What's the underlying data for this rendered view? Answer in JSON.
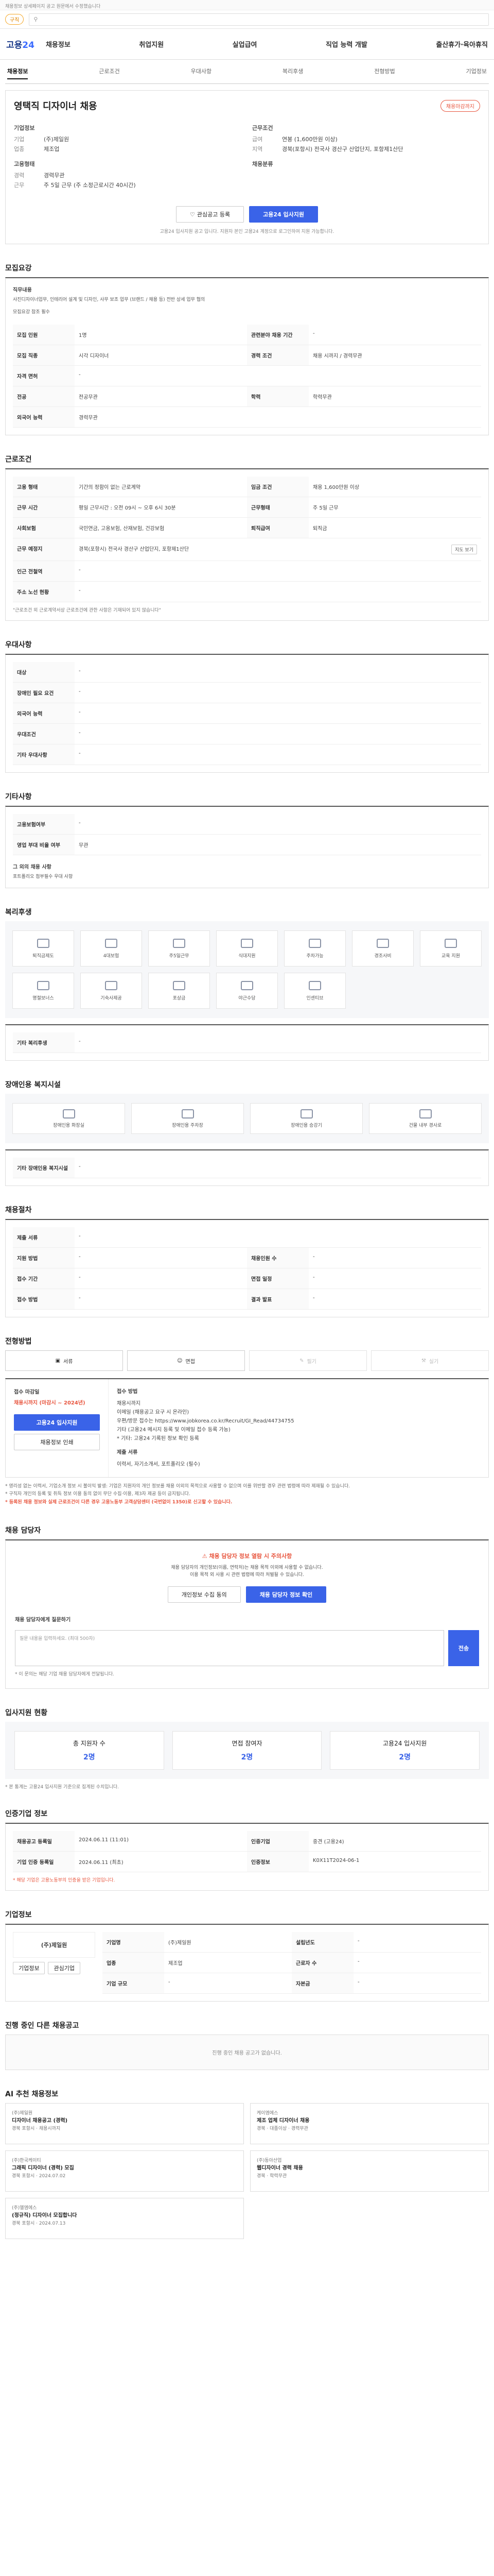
{
  "top_notice": "채용정보 상세페이지 공고 원문에서 수정했습니다",
  "topbar": {
    "chip": "구직",
    "search_placeholder": ""
  },
  "gnb": {
    "logo_a": "고용",
    "logo_b": "24",
    "menu": [
      "채용정보",
      "취업지원",
      "실업급여",
      "직업 능력 개발",
      "출산휴가·육아휴직"
    ]
  },
  "tabs": [
    "채용정보",
    "근로조건",
    "우대사항",
    "복리후생",
    "전형방법",
    "기업정보"
  ],
  "header": {
    "title": "영택직 디자이너 채용",
    "badge": "채용마감까지",
    "company_lbl": "기업정보",
    "company": [
      {
        "k": "기업",
        "v": "(주)제일원"
      },
      {
        "k": "업종",
        "v": "제조업"
      }
    ],
    "cond_lbl": "근무조건",
    "cond": [
      {
        "k": "급여",
        "v": "연봉 (1,600만원 이상)"
      },
      {
        "k": "지역",
        "v": "경북(포항시) 전국사 경산구 산업단지, 포항제1산단"
      }
    ],
    "req_lbl": "고용형태",
    "req": [
      {
        "k": "경력",
        "v": "경력무관"
      },
      {
        "k": "근무",
        "v": "주 5일 근무 (주 소정근로시간 40시간)"
      }
    ],
    "emp_lbl": "채용분류",
    "scrap": "관심공고 등록",
    "apply": "고용24 입사지원",
    "notice": "고용24 입사지원 공고 입니다. 지원자 본인 고용24 계정으로 로그인하여 지원 가능합니다."
  },
  "job": {
    "title": "모집요강",
    "duty_lbl": "직무내용",
    "duty": "사진디자이너업무, 인테리어 설계 및 디자인, 사무 보조 업무 (브랜드 / 채용 등) 전반 상세 업무 협의",
    "etc": "모집요강 참조 필수",
    "rows": [
      [
        "모집 인원",
        "1명",
        "관련분야 채용 기간",
        "-"
      ],
      [
        "모집 직종",
        "시각 디자이너",
        "경력 조건",
        "채용 시까지 / 경력무관"
      ],
      [
        "자격 면허",
        "-",
        "",
        ""
      ],
      [
        "전공",
        "전공무관",
        "학력",
        "학력무관"
      ],
      [
        "외국어 능력",
        "경력무관",
        "",
        ""
      ]
    ]
  },
  "work": {
    "title": "근로조건",
    "rows": [
      [
        "고용 형태",
        "기간의 정함이 없는 근로계약",
        "임금 조건",
        "채용 1,600만원 이상"
      ],
      [
        "근무 시간",
        "평일 근무시간 : 오전 09시 ~ 오후 6시 30분",
        "",
        ""
      ],
      [
        "사회보험",
        "국민연금, 고용보험, 산재보험, 건강보험",
        "퇴직급여",
        "퇴직금"
      ],
      [
        "근무 예정지",
        "경북(포항시) 전국사 경산구 산업단지, 포항제1산단",
        "",
        "지도 보기"
      ],
      [
        "인근 전철역",
        "-",
        "",
        ""
      ],
      [
        "주소 노선 현황",
        "-",
        "",
        ""
      ]
    ],
    "weekly": "주 5일 근무",
    "note": "\"근로조건 외 근로계약서상 근로조건에 관한 사항은 기재되어 있지 않습니다\""
  },
  "pref": {
    "title": "우대사항",
    "rows": [
      [
        "대상",
        "-"
      ],
      [
        "장애인 필요 요건",
        "-"
      ],
      [
        "외국어 능력",
        "-"
      ],
      [
        "우대조건",
        "-"
      ],
      [
        "기타 우대사항",
        "-"
      ]
    ]
  },
  "etc": {
    "title": "기타사항",
    "rows": [
      [
        "고용보험여부",
        "-"
      ],
      [
        "영업 부대 비율 여부",
        "무관"
      ]
    ],
    "cert_lbl": "그 외의 채용 사항",
    "cert": "포트폴리오 첨부필수 우대 사항"
  },
  "welfare": {
    "title": "복리후생",
    "items": [
      "퇴직금제도",
      "4대보험",
      "주5일근무",
      "식대지원",
      "주차가능",
      "경조사비",
      "교육 지원",
      "명절보너스",
      "기숙사제공",
      "포상금",
      "야근수당",
      "인센티브"
    ],
    "etc_lbl": "기타 복리후생",
    "etc": "-"
  },
  "disab": {
    "title": "장애인용 복지시설",
    "items": [
      "장애인용 화장실",
      "장애인용 주차장",
      "장애인용 승강기",
      "건물 내부 경사로"
    ],
    "etc_lbl": "기타 장애인용 복지시설",
    "etc": "-"
  },
  "hire": {
    "title": "채용절차",
    "rows": [
      [
        "제출 서류",
        "-",
        "",
        ""
      ],
      [
        "지원 방법",
        "-",
        "채용인원 수",
        "-"
      ],
      [
        "접수 기간",
        "-",
        "면접 일정",
        "-"
      ],
      [
        "접수 방법",
        "-",
        "결과 발표",
        "-"
      ]
    ]
  },
  "method": {
    "title": "전형방법",
    "items": [
      "서류",
      "면접",
      "필기",
      "실기"
    ]
  },
  "applyx": {
    "title_l": "접수 마감일",
    "deadline": "채용시까지 (마감시 ~ 2024년)",
    "apply": "고용24 입사지원",
    "print": "채용정보 인쇄",
    "title_r": "접수 방법",
    "lines": [
      "채용시까지",
      "이메일 (채용공고 요구 시 온라인)",
      "우편/방문 접수는 https://www.jobkorea.co.kr/Recruit/GI_Read/44734755",
      "기타 (고용24 메시지 등록 및 이메일 접수 등록 가능)",
      "* 기타: 고용24 기록된 정보 확인 등록"
    ],
    "sub_lbl": "제출 서류",
    "subs": "이력서, 자기소개서, 포트폴리오 (필수)"
  },
  "caution": [
    "* 영리성 없는 이력서, 기업소개 정보 시 불이익 발생: 기업은 지원자의 개인 정보를 채용 이외의 목적으로 사용할 수 없으며 이를 위반할 경우 관련 법령에 따라 제재될 수 있습니다.",
    "* 구직자 개인의 등록 및 취득 정보 이용 동의 없이 무단 수집·이용, 제3자 제공 등이 금지됩니다.",
    "* 등록된 채용 정보와 실제 근로조건이 다른 경우 고용노동부 고객상담센터 (국번없이 1350)로 신고할 수 있습니다."
  ],
  "inquiry": {
    "title": "채용 담당자",
    "warn": "채용 담당자 정보 열람 시 주의사항",
    "t1": "채용 담당자의 개인정보(이름, 연락처)는 채용 목적 이외에 사용할 수 없습니다.",
    "t2": "이용 목적 외 사용 시 관련 법령에 따라 처벌될 수 있습니다.",
    "b1": "개인정보 수집 동의",
    "b2": "채용 담당자 정보 확인",
    "q_lbl": "채용 담당자에게 질문하기",
    "q_ph": "질문 내용을 입력하세요. (최대 500자)",
    "send": "전송",
    "q_note": "* 이 문의는 해당 기업 채용 담당자에게 전달됩니다."
  },
  "stats": {
    "title": "입사지원 현황",
    "items": [
      {
        "k": "총 지원자 수",
        "v": "2명"
      },
      {
        "k": "면접 참여자",
        "v": "2명"
      },
      {
        "k": "고용24 입사지원",
        "v": "2명"
      }
    ],
    "note": "* 본 통계는 고용24 입사지원 기준으로 집계된 수치입니다."
  },
  "corp": {
    "title": "인증기업 정보",
    "rows": [
      [
        "채용공고 등록일",
        "2024.06.11 (11:01)",
        "인증기업",
        "중견 (고용24)"
      ],
      [
        "기업 인증 등록일",
        "2024.06.11 (최초)",
        "인증정보",
        "K0X11T2024-06-1"
      ]
    ],
    "note": "* 해당 기업은 고용노동부의 인증을 받은 기업입니다."
  },
  "company": {
    "title": "기업정보",
    "name": "(주)제일원",
    "rows": [
      [
        "기업명",
        "(주)제일원",
        "설립년도",
        "-"
      ],
      [
        "업종",
        "제조업",
        "근로자 수",
        "-"
      ],
      [
        "기업 규모",
        "-",
        "자본금",
        "-"
      ]
    ],
    "btn1": "기업정보",
    "btn2": "관심기업"
  },
  "other": {
    "title": "진행 중인 다른 채용공고",
    "empty": "진행 중인 채용 공고가 없습니다."
  },
  "related": {
    "title": "AI 추천 채용정보",
    "items": [
      {
        "co": "(주)제일원",
        "job": "디자이너 채용공고 (경력)",
        "meta": "경북 포항시 · 채용시까지"
      },
      {
        "co": "케이엠에스",
        "job": "제조 업체 디자이너 채용",
        "meta": "경북 · 대졸이상 · 경력무관"
      },
      {
        "co": "(주)한국케이티",
        "job": "그래픽 디자이너 (경력) 모집",
        "meta": "경북 포항시 · 2024.07.02"
      },
      {
        "co": "(주)동아산업",
        "job": "웹디자이너 경력 채용",
        "meta": "경북 · 학력무관"
      },
      {
        "co": "(주)엘엠에스",
        "job": "(정규직) 디자이너 모집합니다",
        "meta": "경북 포항시 · 2024.07.13"
      }
    ]
  }
}
